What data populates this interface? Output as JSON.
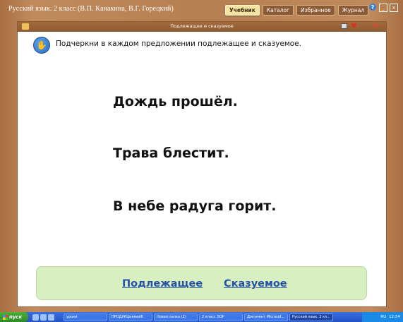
{
  "app": {
    "title": "Русский язык. 2 класс (В.П. Канакина, В.Г. Горецкий)"
  },
  "nav_tabs": [
    {
      "label": "Учебник",
      "active": true
    },
    {
      "label": "Каталог",
      "active": false
    },
    {
      "label": "Избранное",
      "active": false
    },
    {
      "label": "Журнал",
      "active": false
    }
  ],
  "window_controls": {
    "help": "?",
    "minimize": "_",
    "close": "x"
  },
  "lesson": {
    "title": "Подлежащее и сказуемое",
    "instruction": "Подчеркни в каждом предложении подлежащее и сказуемое.",
    "sentences": [
      "Дождь прошёл.",
      "Трава блестит.",
      "В небе радуга горит."
    ],
    "answer_links": [
      "Подлежащее",
      "Сказуемое"
    ]
  },
  "taskbar": {
    "start_label": "пуск",
    "items": [
      {
        "label": "уроки",
        "active": false
      },
      {
        "label": "ПРОДУКЦиямей6",
        "active": false
      },
      {
        "label": "Новая папка (2)",
        "active": false
      },
      {
        "label": "2 класс ЭОР",
        "active": false
      },
      {
        "label": "Документ Microsof...",
        "active": false
      },
      {
        "label": "Русский язык. 2 кл...",
        "active": true
      }
    ],
    "lang": "RU",
    "clock": "12:54"
  },
  "colors": {
    "frame": "#b67f51",
    "accent_tab": "#f6e3a2",
    "answer_box": "#d8efc2",
    "link": "#2552a8",
    "taskbar": "#2453c8"
  }
}
